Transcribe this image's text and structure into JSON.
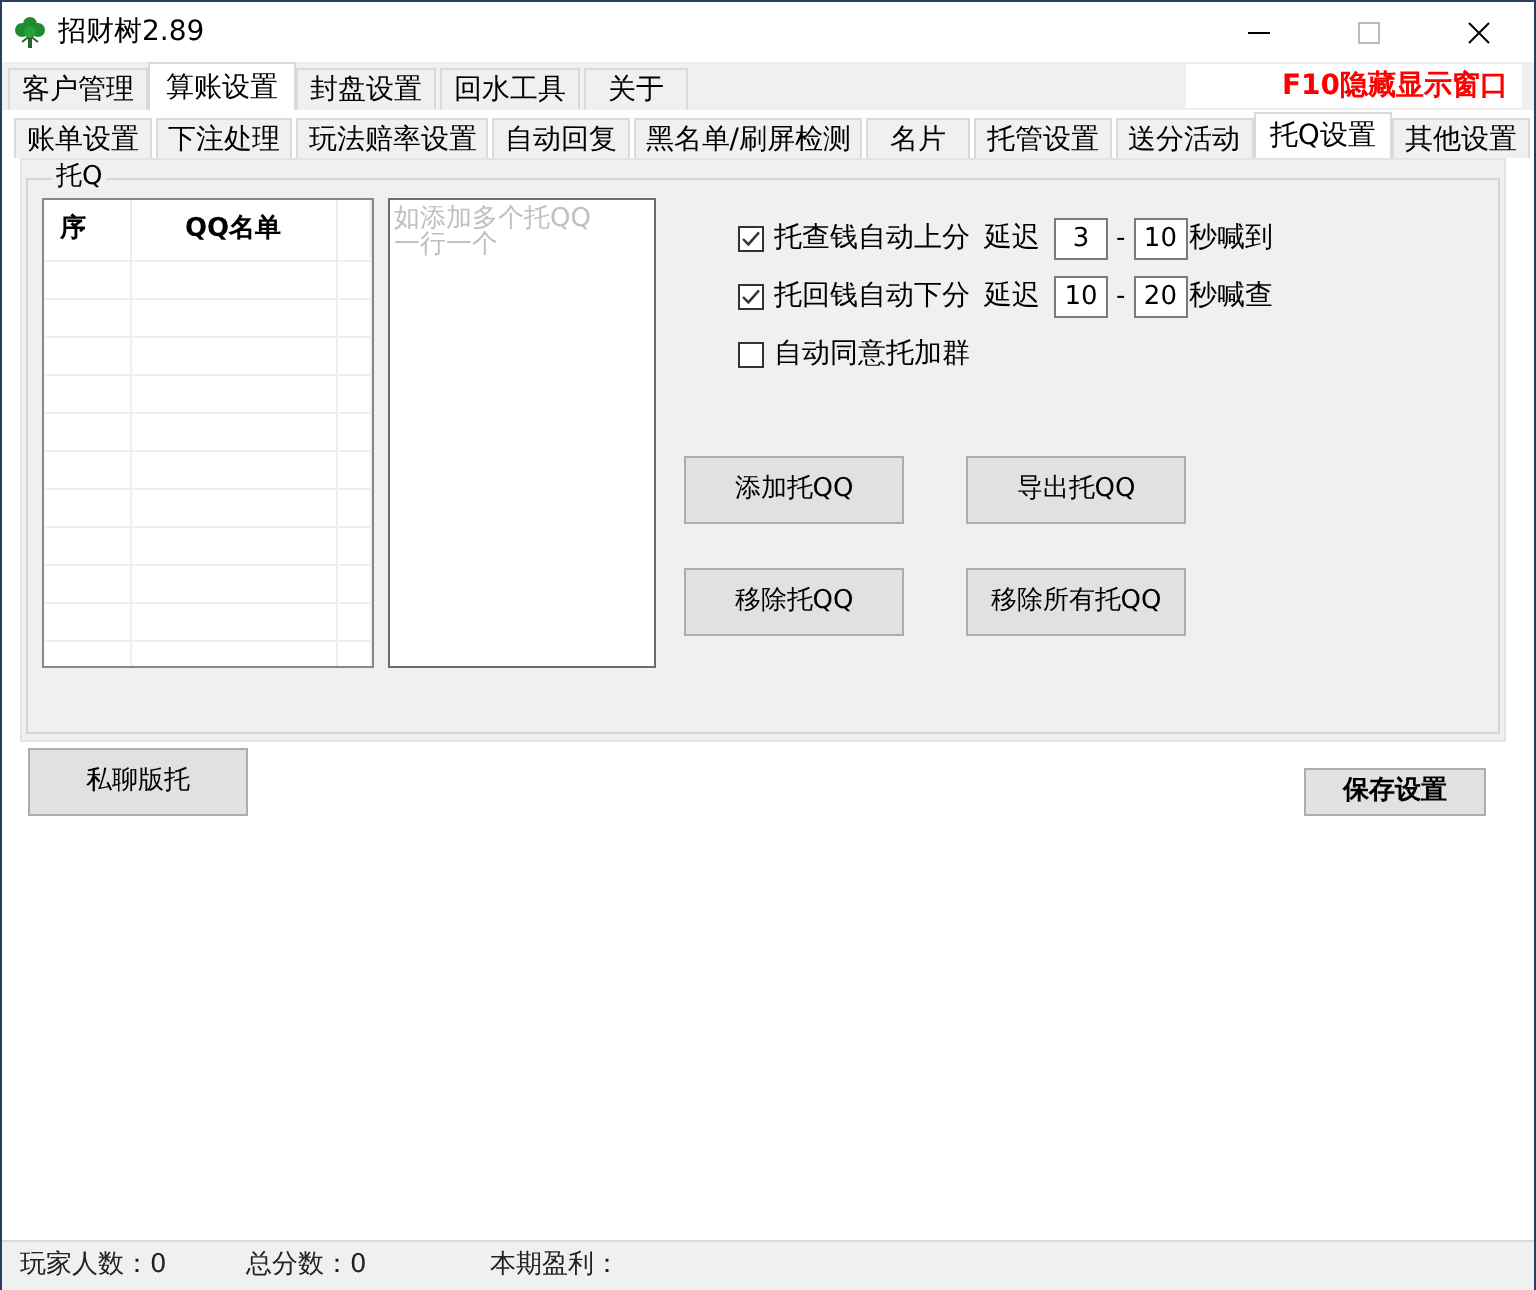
{
  "window": {
    "title": "招财树2.89"
  },
  "main_tabs": [
    {
      "label": "客户管理",
      "selected": false
    },
    {
      "label": "算账设置",
      "selected": true
    },
    {
      "label": "封盘设置",
      "selected": false
    },
    {
      "label": "回水工具",
      "selected": false
    },
    {
      "label": "关于",
      "selected": false
    }
  ],
  "hotkey_hint": "F10隐藏显示窗口",
  "sub_tabs": [
    {
      "label": "账单设置",
      "selected": false
    },
    {
      "label": "下注处理",
      "selected": false
    },
    {
      "label": "玩法赔率设置",
      "selected": false
    },
    {
      "label": "自动回复",
      "selected": false
    },
    {
      "label": "黑名单/刷屏检测",
      "selected": false
    },
    {
      "label": "名片",
      "selected": false
    },
    {
      "label": "托管设置",
      "selected": false
    },
    {
      "label": "送分活动",
      "selected": false
    },
    {
      "label": "托Q设置",
      "selected": true
    },
    {
      "label": "其他设置",
      "selected": false
    }
  ],
  "group": {
    "title": "托Q",
    "list": {
      "columns": [
        "序",
        "QQ名单"
      ]
    },
    "qq_input": {
      "placeholder": "如添加多个托QQ\n一行一个"
    },
    "options": [
      {
        "kind": "delay",
        "label": "托查钱自动上分",
        "checked": true,
        "delay_label": "延迟",
        "from": "3",
        "separator": "-",
        "to": "10",
        "suffix": "秒喊到"
      },
      {
        "kind": "delay",
        "label": "托回钱自动下分",
        "checked": true,
        "delay_label": "延迟",
        "from": "10",
        "separator": "-",
        "to": "20",
        "suffix": "秒喊查"
      },
      {
        "kind": "check",
        "label": "自动同意托加群",
        "checked": false
      }
    ],
    "buttons": [
      "添加托QQ",
      "导出托QQ",
      "移除托QQ",
      "移除所有托QQ"
    ]
  },
  "private_chat_button": "私聊版托",
  "save_button": "保存设置",
  "status_bar": [
    "玩家人数：0",
    "总分数：0",
    "本期盈利："
  ]
}
